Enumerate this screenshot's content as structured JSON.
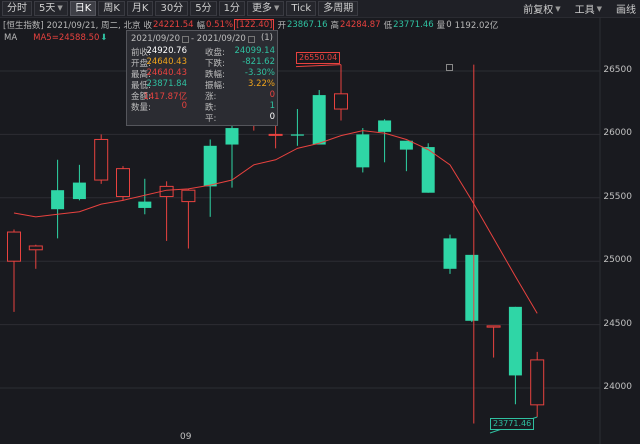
{
  "toolbar": {
    "buttons": [
      "分时",
      "5天",
      "日K",
      "周K",
      "月K",
      "30分",
      "5分",
      "1分",
      "更多",
      "Tick",
      "多周期"
    ],
    "active": "日K",
    "right": [
      "前复权",
      "工具",
      "画线"
    ]
  },
  "infobar": {
    "name": "[恒生指数]",
    "date": "2021/09/21, 周二, 北京",
    "close_label": "收",
    "close": "24221.54",
    "change_pct_label": "幅",
    "change_pct": "0.51%",
    "change": "[122.40]",
    "open_label": "开",
    "open": "23867.16",
    "high_label": "高",
    "high": "24284.87",
    "low_label": "低",
    "low": "23771.46",
    "volume_label": "量",
    "volume": "0",
    "amount": "1192.02亿"
  },
  "ma": {
    "label": "MA",
    "value": "MA5=24588.50"
  },
  "popup": {
    "date_from": "2021/09/20",
    "date_to": "2021/09/20",
    "count": "(1)",
    "rows": [
      [
        {
          "t": "前收:"
        },
        {
          "t": "24920.76",
          "c": "white"
        },
        {
          "t": "收盘:"
        },
        {
          "t": "24099.14",
          "c": "green"
        }
      ],
      [
        {
          "t": "开盘:"
        },
        {
          "t": "24640.43",
          "c": "orange"
        },
        {
          "t": "下跌:"
        },
        {
          "t": "-821.62",
          "c": "green"
        }
      ],
      [
        {
          "t": "最高:"
        },
        {
          "t": "24640.43",
          "c": "red"
        },
        {
          "t": "跌幅:"
        },
        {
          "t": "-3.30%",
          "c": "green"
        }
      ],
      [
        {
          "t": "最低:"
        },
        {
          "t": "23871.84",
          "c": "green"
        },
        {
          "t": "振幅:"
        },
        {
          "t": "3.22%",
          "c": "orange"
        }
      ],
      [
        {
          "t": "金额:"
        },
        {
          "t": "1417.87亿",
          "c": "red"
        },
        {
          "t": "涨:"
        },
        {
          "t": "0",
          "c": "red"
        }
      ],
      [
        {
          "t": "数量:"
        },
        {
          "t": "0",
          "c": "red"
        },
        {
          "t": "跌:"
        },
        {
          "t": "1",
          "c": "green"
        }
      ],
      [
        {
          "t": ""
        },
        {
          "t": ""
        },
        {
          "t": "平:"
        },
        {
          "t": "0",
          "c": "white"
        }
      ]
    ]
  },
  "y_axis_labels": [
    "26500",
    "26000",
    "25500",
    "25000",
    "24500",
    "24000"
  ],
  "x_axis_label": "09",
  "high_tag": "26550.04",
  "low_tag": "23771.46",
  "chart_data": {
    "type": "candlestick",
    "ylim": [
      23720,
      26650
    ],
    "y_ticks": [
      26500,
      26000,
      25500,
      25000,
      24500,
      24000
    ],
    "x_tick_labels": [
      "09"
    ],
    "candles": [
      {
        "open": 25000,
        "high": 25250,
        "low": 24600,
        "close": 25230
      },
      {
        "open": 25090,
        "high": 25130,
        "low": 24940,
        "close": 25120
      },
      {
        "open": 25560,
        "high": 25800,
        "low": 25180,
        "close": 25410
      },
      {
        "open": 25620,
        "high": 25760,
        "low": 25480,
        "close": 25490
      },
      {
        "open": 25640,
        "high": 26000,
        "low": 25610,
        "close": 25960
      },
      {
        "open": 25510,
        "high": 25750,
        "low": 25480,
        "close": 25730
      },
      {
        "open": 25470,
        "high": 25650,
        "low": 25370,
        "close": 25420
      },
      {
        "open": 25510,
        "high": 25630,
        "low": 25160,
        "close": 25590
      },
      {
        "open": 25470,
        "high": 25570,
        "low": 25100,
        "close": 25560
      },
      {
        "open": 25910,
        "high": 25960,
        "low": 25350,
        "close": 25590
      },
      {
        "open": 26050,
        "high": 26170,
        "low": 25580,
        "close": 25920
      },
      {
        "open": 26110,
        "high": 26220,
        "low": 26030,
        "close": 26170
      },
      {
        "open": 26000,
        "high": 26100,
        "low": 25890,
        "close": 26000
      },
      {
        "open": 26000,
        "high": 26200,
        "low": 25910,
        "close": 25990
      },
      {
        "open": 26310,
        "high": 26350,
        "low": 25930,
        "close": 25920
      },
      {
        "open": 26200,
        "high": 26550,
        "low": 26110,
        "close": 26320
      },
      {
        "open": 26000,
        "high": 26050,
        "low": 25700,
        "close": 25740
      },
      {
        "open": 26110,
        "high": 26120,
        "low": 25780,
        "close": 26020
      },
      {
        "open": 25950,
        "high": 25950,
        "low": 25710,
        "close": 25880
      },
      {
        "open": 25900,
        "high": 25930,
        "low": 25540,
        "close": 25540
      },
      {
        "open": 25180,
        "high": 25210,
        "low": 24900,
        "close": 24940
      },
      {
        "open": 25050,
        "high": 25040,
        "low": 24520,
        "close": 24530
      },
      {
        "open": 24480,
        "high": 24480,
        "low": 24240,
        "close": 24490
      },
      {
        "open": 24640,
        "high": 24640,
        "low": 23871.84,
        "close": 24099.14
      },
      {
        "open": 23867.16,
        "high": 24284.87,
        "low": 23771.46,
        "close": 24221.54
      }
    ],
    "ma5": [
      25380,
      25350,
      25370,
      25390,
      25450,
      25480,
      25520,
      25560,
      25570,
      25600,
      25640,
      25760,
      25800,
      25890,
      25930,
      25990,
      26030,
      26010,
      25960,
      25880,
      25760,
      25480,
      25180,
      24880,
      24588.5
    ],
    "up_color": "#e8423f",
    "down_color": "#2fd6a6",
    "ma_color": "#e8423f"
  }
}
